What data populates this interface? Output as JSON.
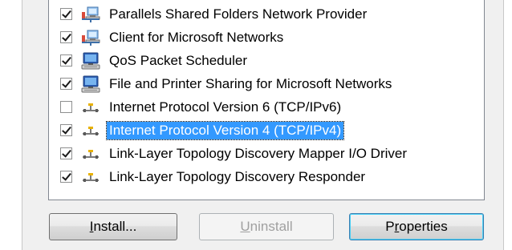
{
  "components": [
    {
      "label": "Parallels Shared Folders Network Provider",
      "checked": true,
      "selected": false,
      "icon": "network-client-icon"
    },
    {
      "label": "Client for Microsoft Networks",
      "checked": true,
      "selected": false,
      "icon": "network-client-icon"
    },
    {
      "label": "QoS Packet Scheduler",
      "checked": true,
      "selected": false,
      "icon": "network-service-icon"
    },
    {
      "label": "File and Printer Sharing for Microsoft Networks",
      "checked": true,
      "selected": false,
      "icon": "network-service-icon"
    },
    {
      "label": "Internet Protocol Version 6 (TCP/IPv6)",
      "checked": false,
      "selected": false,
      "icon": "protocol-icon"
    },
    {
      "label": "Internet Protocol Version 4 (TCP/IPv4)",
      "checked": true,
      "selected": true,
      "icon": "protocol-icon"
    },
    {
      "label": "Link-Layer Topology Discovery Mapper I/O Driver",
      "checked": true,
      "selected": false,
      "icon": "protocol-icon"
    },
    {
      "label": "Link-Layer Topology Discovery Responder",
      "checked": true,
      "selected": false,
      "icon": "protocol-icon"
    }
  ],
  "buttons": {
    "install": {
      "mnemonic": "I",
      "rest": "nstall..."
    },
    "uninstall": {
      "mnemonic": "U",
      "rest": "ninstall"
    },
    "properties": {
      "before": "P",
      "mnemonic": "r",
      "rest": "operties"
    }
  },
  "colors": {
    "selection": "#3399ff",
    "window": "#f0f0f0"
  }
}
